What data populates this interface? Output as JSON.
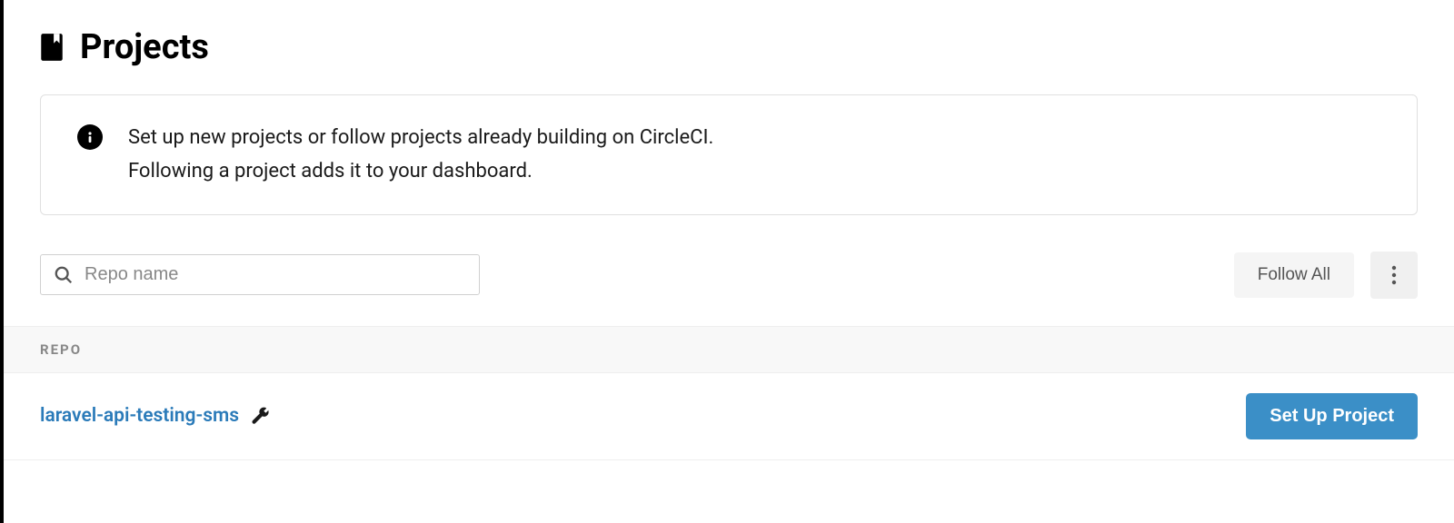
{
  "header": {
    "title": "Projects"
  },
  "info": {
    "line1": "Set up new projects or follow projects already building on CircleCI.",
    "line2": "Following a project adds it to your dashboard."
  },
  "search": {
    "placeholder": "Repo name",
    "value": ""
  },
  "toolbar": {
    "follow_all_label": "Follow All"
  },
  "table": {
    "column_header": "REPO",
    "rows": [
      {
        "name": "laravel-api-testing-sms",
        "action_label": "Set Up Project"
      }
    ]
  }
}
